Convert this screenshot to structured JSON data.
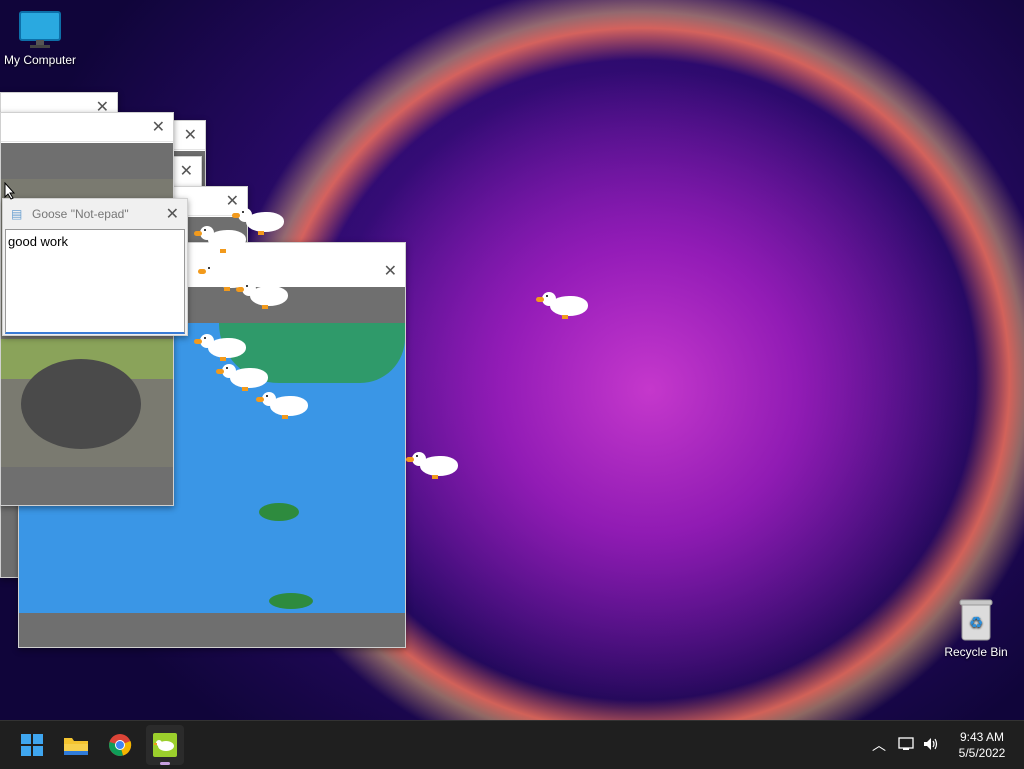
{
  "desktop": {
    "icons": [
      {
        "label": "My Computer"
      },
      {
        "label": "Recycle Bin"
      }
    ]
  },
  "notepad": {
    "title": "Goose \"Not-epad\"",
    "content": "good work"
  },
  "taskbar": {
    "time": "9:43 AM",
    "date": "5/5/2022",
    "accent": "#0078d4"
  },
  "colors": {
    "window_grey": "#6f6f6f",
    "pond_blue": "#3a96e6",
    "goose_beak": "#f29a1c"
  }
}
